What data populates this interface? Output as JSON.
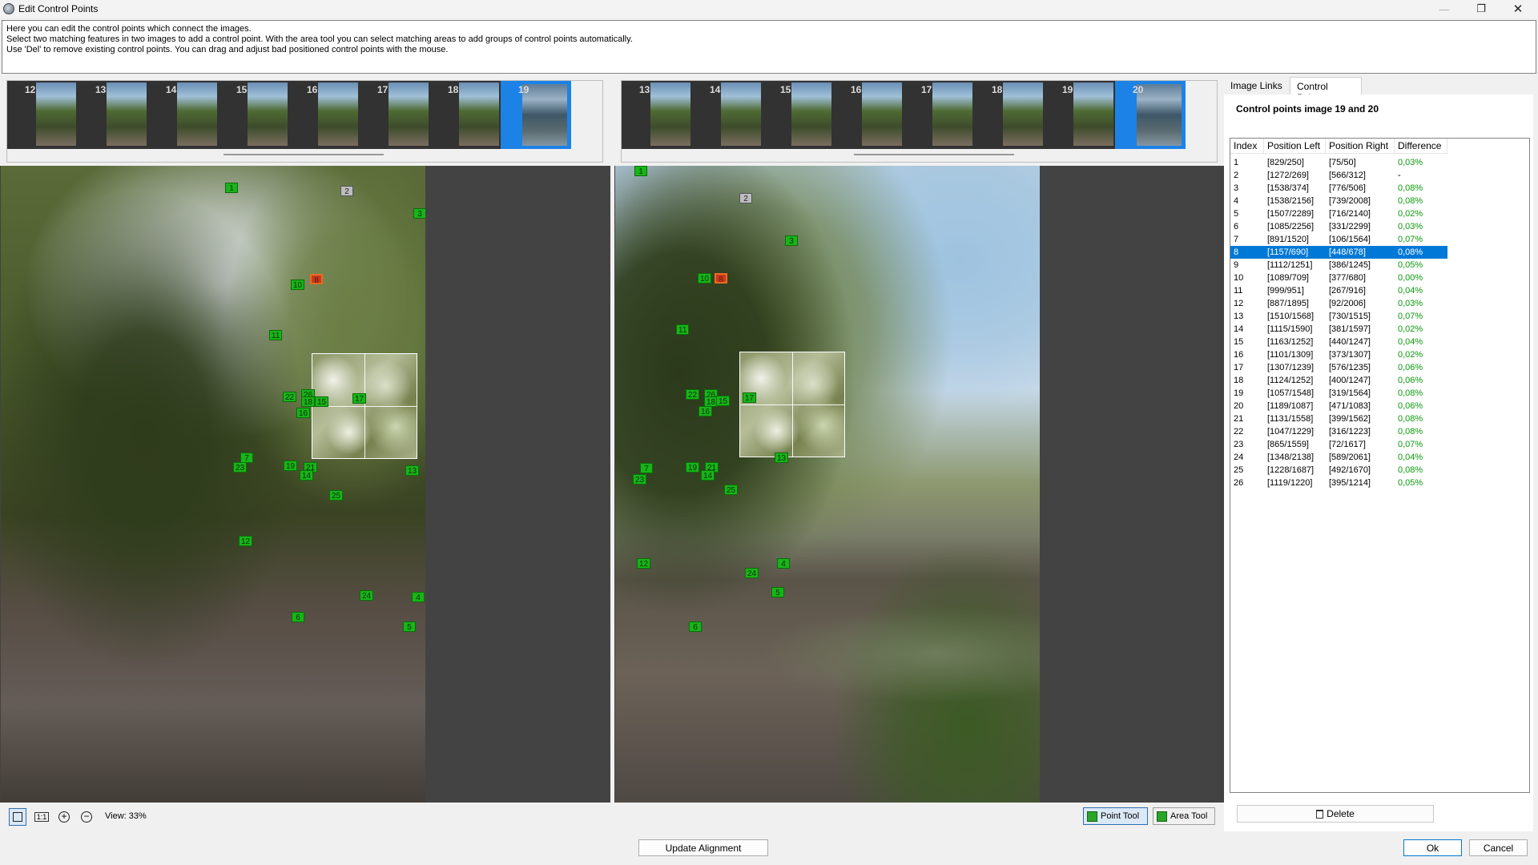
{
  "window": {
    "title": "Edit Control Points",
    "minimize": "—",
    "maximize": "❐",
    "close": "✕"
  },
  "instructions": [
    "Here you can edit the control points which connect the images.",
    "Select two matching features in two images to add a control point. With the area tool you can select matching areas to add groups of control points automatically.",
    "Use 'Del' to remove existing control points. You can drag and adjust bad positioned control points with the mouse."
  ],
  "left_strip": {
    "labels": [
      "12",
      "13",
      "14",
      "15",
      "16",
      "17",
      "18",
      "19"
    ],
    "selected": "19"
  },
  "right_strip": {
    "labels": [
      "13",
      "14",
      "15",
      "16",
      "17",
      "18",
      "19",
      "20"
    ],
    "selected": "20"
  },
  "left_markers": [
    {
      "label": "1"
    },
    {
      "label": "2"
    },
    {
      "label": "3"
    },
    {
      "label": "10"
    },
    {
      "label": "8"
    },
    {
      "label": "11"
    },
    {
      "label": "22"
    },
    {
      "label": "26"
    },
    {
      "label": "18"
    },
    {
      "label": "15"
    },
    {
      "label": "17"
    },
    {
      "label": "16"
    },
    {
      "label": "7"
    },
    {
      "label": "23"
    },
    {
      "label": "19"
    },
    {
      "label": "21"
    },
    {
      "label": "14"
    },
    {
      "label": "13"
    },
    {
      "label": "25"
    },
    {
      "label": "12"
    },
    {
      "label": "24"
    },
    {
      "label": "4"
    },
    {
      "label": "6"
    },
    {
      "label": "5"
    }
  ],
  "right_markers": [
    {
      "label": "1"
    },
    {
      "label": "2"
    },
    {
      "label": "3"
    },
    {
      "label": "10"
    },
    {
      "label": "8"
    },
    {
      "label": "11"
    },
    {
      "label": "22"
    },
    {
      "label": "26"
    },
    {
      "label": "18"
    },
    {
      "label": "15"
    },
    {
      "label": "17"
    },
    {
      "label": "16"
    },
    {
      "label": "7"
    },
    {
      "label": "23"
    },
    {
      "label": "19"
    },
    {
      "label": "21"
    },
    {
      "label": "14"
    },
    {
      "label": "13"
    },
    {
      "label": "25"
    },
    {
      "label": "12"
    },
    {
      "label": "24"
    },
    {
      "label": "4"
    },
    {
      "label": "5"
    },
    {
      "label": "6"
    }
  ],
  "toolbar": {
    "view_text": "View: 33%",
    "point_tool": "Point Tool",
    "area_tool": "Area Tool",
    "one_to_one": "1:1"
  },
  "tabs": {
    "image_links": "Image Links",
    "control_points": "Control Points"
  },
  "panel_title": "Control points image 19 and 20",
  "table": {
    "headers": [
      "Index",
      "Position Left",
      "Position Right",
      "Difference"
    ],
    "selected_index": "8",
    "rows": [
      [
        "1",
        "[829/250]",
        "[75/50]",
        "0,03%"
      ],
      [
        "2",
        "[1272/269]",
        "[566/312]",
        "-"
      ],
      [
        "3",
        "[1538/374]",
        "[776/506]",
        "0,08%"
      ],
      [
        "4",
        "[1538/2156]",
        "[739/2008]",
        "0,08%"
      ],
      [
        "5",
        "[1507/2289]",
        "[716/2140]",
        "0,02%"
      ],
      [
        "6",
        "[1085/2256]",
        "[331/2299]",
        "0,03%"
      ],
      [
        "7",
        "[891/1520]",
        "[106/1564]",
        "0,07%"
      ],
      [
        "8",
        "[1157/690]",
        "[448/678]",
        "0,08%"
      ],
      [
        "9",
        "[1112/1251]",
        "[386/1245]",
        "0,05%"
      ],
      [
        "10",
        "[1089/709]",
        "[377/680]",
        "0,00%"
      ],
      [
        "11",
        "[999/951]",
        "[267/916]",
        "0,04%"
      ],
      [
        "12",
        "[887/1895]",
        "[92/2006]",
        "0,03%"
      ],
      [
        "13",
        "[1510/1568]",
        "[730/1515]",
        "0,07%"
      ],
      [
        "14",
        "[1115/1590]",
        "[381/1597]",
        "0,02%"
      ],
      [
        "15",
        "[1163/1252]",
        "[440/1247]",
        "0,04%"
      ],
      [
        "16",
        "[1101/1309]",
        "[373/1307]",
        "0,02%"
      ],
      [
        "17",
        "[1307/1239]",
        "[576/1235]",
        "0,06%"
      ],
      [
        "18",
        "[1124/1252]",
        "[400/1247]",
        "0,06%"
      ],
      [
        "19",
        "[1057/1548]",
        "[319/1564]",
        "0,08%"
      ],
      [
        "20",
        "[1189/1087]",
        "[471/1083]",
        "0,06%"
      ],
      [
        "21",
        "[1131/1558]",
        "[399/1562]",
        "0,08%"
      ],
      [
        "22",
        "[1047/1229]",
        "[316/1223]",
        "0,08%"
      ],
      [
        "23",
        "[865/1559]",
        "[72/1617]",
        "0,07%"
      ],
      [
        "24",
        "[1348/2138]",
        "[589/2061]",
        "0,04%"
      ],
      [
        "25",
        "[1228/1687]",
        "[492/1670]",
        "0,08%"
      ],
      [
        "26",
        "[1119/1220]",
        "[395/1214]",
        "0,05%"
      ]
    ]
  },
  "buttons": {
    "delete": "Delete",
    "update_alignment": "Update Alignment",
    "ok": "Ok",
    "cancel": "Cancel"
  },
  "colors": {
    "selection": "#0078d7",
    "marker": "#18b418",
    "difference_text": "#0a9a0a"
  }
}
